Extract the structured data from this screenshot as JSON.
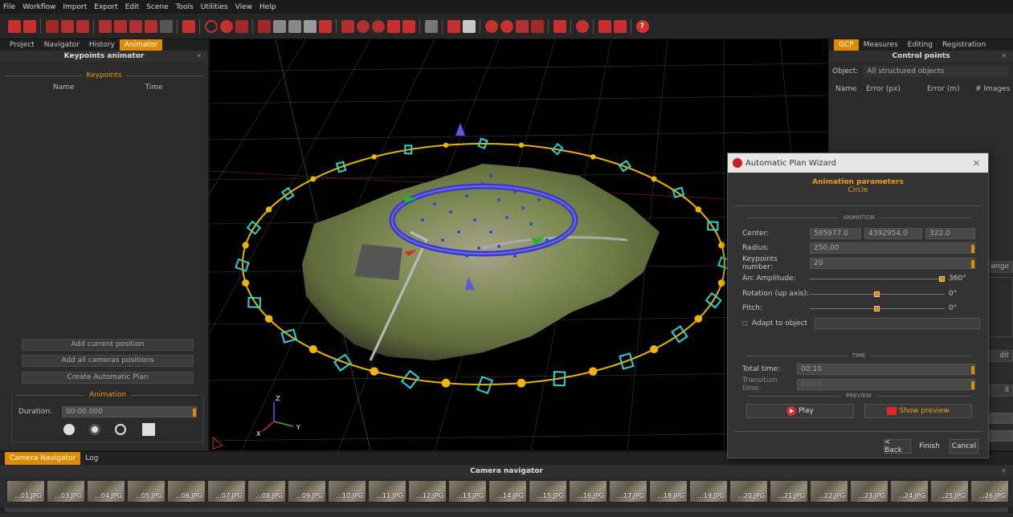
{
  "menu": [
    "File",
    "Workflow",
    "Import",
    "Export",
    "Edit",
    "Scene",
    "Tools",
    "Utilities",
    "View",
    "Help"
  ],
  "left_panel": {
    "tabs": [
      "Project",
      "Navigator",
      "History",
      "Animator"
    ],
    "active_tab": "Animator",
    "title": "Keypoints animator",
    "keypoints_section": "Keypoints",
    "columns": [
      "Name",
      "Time"
    ],
    "buttons": [
      "Add current position",
      "Add all cameras positions",
      "Create Automatic Plan"
    ],
    "animation_section": "Animation",
    "duration_label": "Duration:",
    "duration_value": "00:00.000"
  },
  "right_panel": {
    "tabs": [
      "GCP",
      "Measures",
      "Editing",
      "Registration"
    ],
    "active_tab": "GCP",
    "title": "Control points",
    "object_label": "Object:",
    "object_value": "All structured objects",
    "columns": [
      "Name",
      "Error (px)",
      "Error (m)",
      "# Images"
    ],
    "partial_change": "ange",
    "partial_edit": "dit",
    "partial_all": "ll"
  },
  "dialog": {
    "title": "Automatic Plan Wizard",
    "heading": "Animation parameters",
    "subheading": "Circle",
    "animation_section": "ANIMATION",
    "center_label": "Center:",
    "center_x": "585977.0",
    "center_y": "4392954.0",
    "center_z": "322.0",
    "radius_label": "Radius:",
    "radius_value": "250,00",
    "keypoints_label": "Keypoints number:",
    "keypoints_value": "20",
    "arc_label": "Arc Amplitude:",
    "arc_value": "360°",
    "rotation_label": "Rotation (up axis):",
    "rotation_value": "0°",
    "pitch_label": "Pitch:",
    "pitch_value": "0°",
    "adapt_label": "Adapt to object",
    "time_section": "TIME",
    "total_time_label": "Total time:",
    "total_time_value": "00:10",
    "transition_label": "Transition time:",
    "transition_value": "00:03",
    "preview_section": "PREVIEW",
    "play_label": "Play",
    "show_preview_label": "Show preview",
    "back_label": "< Back",
    "finish_label": "Finish",
    "cancel_label": "Cancel"
  },
  "bottom": {
    "tabs": [
      "Camera Navigator",
      "Log"
    ],
    "active_tab": "Camera Navigator",
    "title": "Camera navigator",
    "thumbnails": [
      "...01.JPG",
      "...03.JPG",
      "...04.JPG",
      "...05.JPG",
      "...06.JPG",
      "...07.JPG",
      "...08.JPG",
      "...09.JPG",
      "...10.JPG",
      "...11.JPG",
      "...12.JPG",
      "...13.JPG",
      "...14.JPG",
      "...15.JPG",
      "...16.JPG",
      "...17.JPG",
      "...18.JPG",
      "...19.JPG",
      "...20.JPG",
      "...21.JPG",
      "...22.JPG",
      "...23.JPG",
      "...24.JPG",
      "...25.JPG",
      "...26.JPG"
    ]
  },
  "axes": {
    "z": "Z",
    "x": "X",
    "y": "Y"
  },
  "colors": {
    "accent": "#e08a00",
    "camera": "#2ad4d4",
    "keypoint": "#f2b400",
    "ring": "#3a3ab8"
  }
}
